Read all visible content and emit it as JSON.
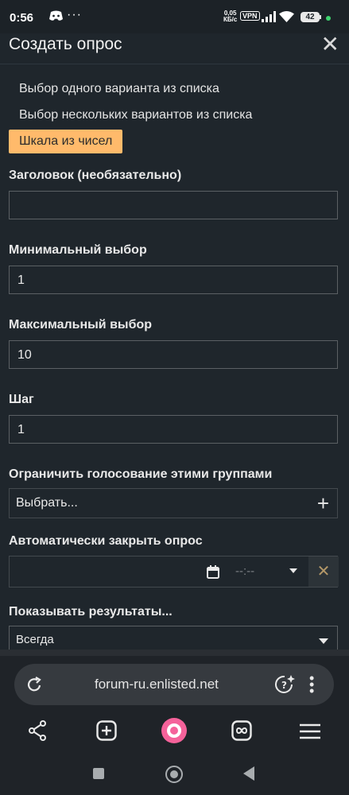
{
  "status_bar": {
    "time": "0:56",
    "speed": "0,05",
    "speed_unit": "КБ/с",
    "vpn": "VPN",
    "battery": "42"
  },
  "modal": {
    "title": "Создать опрос",
    "close_icon": "close-icon"
  },
  "poll_types": [
    {
      "label": "Выбор одного варианта из списка",
      "selected": false
    },
    {
      "label": "Выбор нескольких вариантов из списка",
      "selected": false
    },
    {
      "label": "Шкала из чисел",
      "selected": true
    }
  ],
  "fields": {
    "title_label": "Заголовок (необязательно)",
    "title_value": "",
    "min_label": "Минимальный выбор",
    "min_value": "1",
    "max_label": "Максимальный выбор",
    "max_value": "10",
    "step_label": "Шаг",
    "step_value": "1",
    "groups_label": "Ограничить голосование этими группами",
    "groups_value": "Выбрать...",
    "autoclose_label": "Автоматически закрыть опрос",
    "time_placeholder": "--:--",
    "results_label": "Показывать результаты...",
    "results_value": "Всегда"
  },
  "browser": {
    "url": "forum-ru.enlisted.net"
  },
  "colors": {
    "background": "#1f262c",
    "accent": "#ffba6b",
    "clear_icon": "#b49868"
  },
  "icons": [
    "discord-icon",
    "more-icon",
    "signal-icon",
    "wifi-icon",
    "battery-icon",
    "calendar-icon",
    "plus-icon",
    "reload-icon",
    "assistant-icon",
    "share-icon",
    "new-tab-icon",
    "alice-icon",
    "tabs-icon",
    "menu-icon"
  ]
}
